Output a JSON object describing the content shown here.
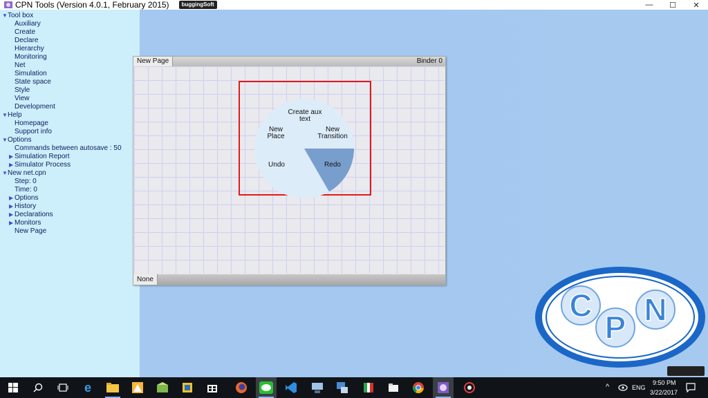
{
  "window": {
    "title": "CPN Tools (Version 4.0.1, February 2015)",
    "brand_logo": "buggingSoft",
    "controls": {
      "minimize": "—",
      "maximize": "☐",
      "close": "✕"
    }
  },
  "tree": {
    "rows": [
      {
        "label": "Tool box",
        "level": 0,
        "arrow": "▼"
      },
      {
        "label": "Auxiliary",
        "level": 1,
        "arrow": ""
      },
      {
        "label": "Create",
        "level": 1,
        "arrow": ""
      },
      {
        "label": "Declare",
        "level": 1,
        "arrow": ""
      },
      {
        "label": "Hierarchy",
        "level": 1,
        "arrow": ""
      },
      {
        "label": "Monitoring",
        "level": 1,
        "arrow": ""
      },
      {
        "label": "Net",
        "level": 1,
        "arrow": ""
      },
      {
        "label": "Simulation",
        "level": 1,
        "arrow": ""
      },
      {
        "label": "State space",
        "level": 1,
        "arrow": ""
      },
      {
        "label": "Style",
        "level": 1,
        "arrow": ""
      },
      {
        "label": "View",
        "level": 1,
        "arrow": ""
      },
      {
        "label": "Development",
        "level": 1,
        "arrow": ""
      },
      {
        "label": "Help",
        "level": 0,
        "arrow": "▼"
      },
      {
        "label": "Homepage",
        "level": 1,
        "arrow": ""
      },
      {
        "label": "Support info",
        "level": 1,
        "arrow": ""
      },
      {
        "label": "Options",
        "level": 0,
        "arrow": "▼"
      },
      {
        "label": "Commands between autosave : 50",
        "level": 1,
        "arrow": ""
      },
      {
        "label": "Simulation Report",
        "level": 1,
        "arrow": "▶"
      },
      {
        "label": "Simulator Process",
        "level": 1,
        "arrow": "▶"
      },
      {
        "label": "New net.cpn",
        "level": 0,
        "arrow": "▼"
      },
      {
        "label": "Step: 0",
        "level": 1,
        "arrow": ""
      },
      {
        "label": "Time: 0",
        "level": 1,
        "arrow": ""
      },
      {
        "label": "Options",
        "level": 1,
        "arrow": "▶"
      },
      {
        "label": "History",
        "level": 1,
        "arrow": "▶"
      },
      {
        "label": "Declarations",
        "level": 1,
        "arrow": "▶"
      },
      {
        "label": "Monitors",
        "level": 1,
        "arrow": "▶"
      },
      {
        "label": "New Page",
        "level": 1,
        "arrow": ""
      }
    ]
  },
  "binder": {
    "tab_label": "New Page",
    "binder_label": "Binder 0",
    "bottom_tab": "None"
  },
  "pie_menu": {
    "items": {
      "top": "Create aux text",
      "top_left": "New Place",
      "top_right": "New Transition",
      "left": "Undo",
      "right": "Redo"
    },
    "highlighted": "right",
    "colors": {
      "base": "#dcecf8",
      "highlight": "#789ecd"
    }
  },
  "logo": {
    "text": "CPN",
    "colors": {
      "ring": "#1b67c7",
      "letters": "#3a84d8"
    }
  },
  "taskbar": {
    "clock_time": "9:50 PM",
    "clock_date": "3/22/2017",
    "language": "ENG",
    "icons": [
      "windows-start",
      "search",
      "task-view",
      "edge",
      "file-explorer",
      "store-alert",
      "app-2",
      "app-3",
      "store",
      "firefox",
      "line",
      "visual-studio",
      "app-network",
      "app-computer",
      "app-flag",
      "app-white",
      "chrome",
      "cpn-tools",
      "app-red"
    ]
  }
}
